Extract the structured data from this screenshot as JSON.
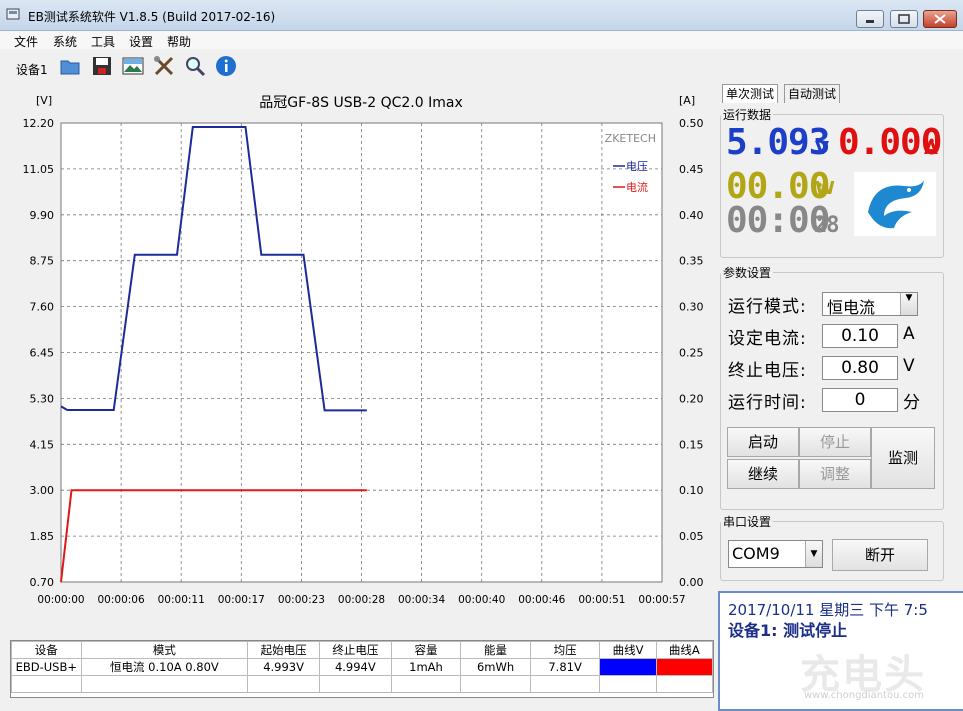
{
  "window": {
    "title": "EB测试系统软件 V1.8.5 (Build 2017-02-16)"
  },
  "menu": [
    "文件",
    "系统",
    "工具",
    "设置",
    "帮助"
  ],
  "toolbar": {
    "device": "设备1",
    "icons": [
      "folder-icon",
      "save-icon",
      "image-icon",
      "tools-icon",
      "search-icon",
      "info-icon"
    ]
  },
  "chart_data": {
    "type": "line",
    "title": "品冠GF-8S USB-2  QC2.0 Imax",
    "brand": "ZKETECH",
    "y_left_unit": "[V]",
    "y_right_unit": "[A]",
    "y_left_ticks": [
      "12.20",
      "11.05",
      "9.90",
      "8.75",
      "7.60",
      "6.45",
      "5.30",
      "4.15",
      "3.00",
      "1.85",
      "0.70"
    ],
    "y_right_ticks": [
      "0.50",
      "0.45",
      "0.40",
      "0.35",
      "0.30",
      "0.25",
      "0.20",
      "0.15",
      "0.10",
      "0.05",
      "0.00"
    ],
    "x_ticks": [
      "00:00:00",
      "00:00:06",
      "00:00:11",
      "00:00:17",
      "00:00:23",
      "00:00:28",
      "00:00:34",
      "00:00:40",
      "00:00:46",
      "00:00:51",
      "00:00:57"
    ],
    "ylim_left": [
      0.7,
      12.2
    ],
    "ylim_right": [
      0.0,
      0.5
    ],
    "xlim": [
      0,
      57
    ],
    "grid": true,
    "legend_position": "top-right",
    "series": [
      {
        "name": "电压",
        "axis": "left",
        "color": "#1c2b96",
        "x": [
          0,
          0.6,
          5,
          7,
          11,
          12.5,
          13.5,
          17.5,
          19,
          23,
          25,
          29
        ],
        "y": [
          5.1,
          5.01,
          5.01,
          8.9,
          8.9,
          12.1,
          12.1,
          12.1,
          8.9,
          8.9,
          5.0,
          5.0
        ]
      },
      {
        "name": "电流",
        "axis": "right",
        "color": "#e01818",
        "x": [
          0,
          1,
          29
        ],
        "y": [
          0.0,
          0.1,
          0.1
        ]
      }
    ]
  },
  "table": {
    "headers": [
      "设备",
      "模式",
      "起始电压",
      "终止电压",
      "容量",
      "能量",
      "均压",
      "曲线V",
      "曲线A"
    ],
    "row": [
      "EBD-USB+",
      "恒电流 0.10A 0.80V",
      "4.993V",
      "4.994V",
      "1mAh",
      "6mWh",
      "7.81V",
      "",
      ""
    ],
    "swatch_v": "#0000ff",
    "swatch_a": "#ff0000"
  },
  "tabs": [
    "单次测试",
    "自动测试"
  ],
  "run_data": {
    "group_label": "运行数据",
    "voltage": "5.093",
    "voltage_unit": "V",
    "current": "0.000",
    "current_unit": "A",
    "power": "00.00",
    "power_unit": "W",
    "timer": "00:00",
    "timer_sec": "28"
  },
  "params": {
    "group_label": "参数设置",
    "mode_label": "运行模式:",
    "mode_value": "恒电流",
    "current_label": "设定电流:",
    "current_value": "0.10",
    "current_unit": "A",
    "cutoff_label": "终止电压:",
    "cutoff_value": "0.80",
    "cutoff_unit": "V",
    "time_label": "运行时间:",
    "time_value": "0",
    "time_unit": "分",
    "btn_start": "启动",
    "btn_stop": "停止",
    "btn_continue": "继续",
    "btn_adjust": "调整",
    "btn_monitor": "监测"
  },
  "serial": {
    "group_label": "串口设置",
    "port": "COM9",
    "btn_disconnect": "断开"
  },
  "status": {
    "datetime": "2017/10/11 星期三 下午 7:5",
    "message": "设备1: 测试停止"
  },
  "watermark": {
    "text": "充电头",
    "url": "www.chongdiantou.com"
  }
}
